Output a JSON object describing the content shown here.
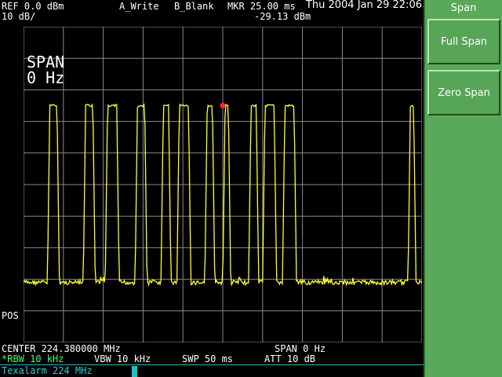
{
  "header": {
    "datetime": "Thu 2004 Jan 29 22:06",
    "ref_level": "REF 0.0 dBm",
    "scale": "10 dB/",
    "trace_a": "A_Write",
    "trace_b": "B_Blank",
    "marker_time": "MKR 25.00 ms",
    "marker_level": "-29.13 dBm"
  },
  "plot": {
    "span_label": "SPAN",
    "span_value": "0 Hz",
    "pos_label": "POS"
  },
  "footer": {
    "center": "CENTER 224.380000 MHz",
    "span": "SPAN 0 Hz",
    "rbw": "*RBW 10 kHz",
    "vbw": "VBW 10 kHz",
    "sweep": "SWP 50 ms",
    "attenuation": "ATT 10 dB"
  },
  "status": {
    "title": "Texalarm 224 MHz"
  },
  "menu": {
    "title": "Span",
    "buttons": [
      "Full Span",
      "Zero Span"
    ]
  },
  "trace": {
    "color": "#ffff33",
    "marker_color": "#ff2a2a",
    "high_level_div": 2.5,
    "noise_level_div": 8.1,
    "bursts": [
      [
        0.6,
        0.9
      ],
      [
        1.5,
        1.8
      ],
      [
        2.05,
        2.4
      ],
      [
        2.8,
        3.1
      ],
      [
        3.45,
        3.7
      ],
      [
        3.85,
        4.2
      ],
      [
        4.55,
        4.8
      ],
      [
        5.0,
        5.2
      ],
      [
        5.65,
        5.9
      ],
      [
        6.0,
        6.35
      ],
      [
        6.5,
        6.85
      ],
      [
        9.65,
        9.85
      ]
    ]
  }
}
